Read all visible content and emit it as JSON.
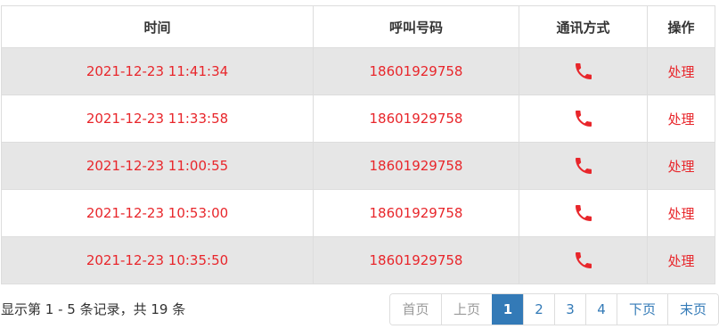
{
  "table": {
    "headers": [
      "时间",
      "呼叫号码",
      "通讯方式",
      "操作"
    ],
    "rows": [
      {
        "time": "2021-12-23 11:41:34",
        "number": "18601929758",
        "icon": "phone-icon",
        "action": "处理"
      },
      {
        "time": "2021-12-23 11:33:58",
        "number": "18601929758",
        "icon": "phone-icon",
        "action": "处理"
      },
      {
        "time": "2021-12-23 11:00:55",
        "number": "18601929758",
        "icon": "phone-icon",
        "action": "处理"
      },
      {
        "time": "2021-12-23 10:53:00",
        "number": "18601929758",
        "icon": "phone-icon",
        "action": "处理"
      },
      {
        "time": "2021-12-23 10:35:50",
        "number": "18601929758",
        "icon": "phone-icon",
        "action": "处理"
      }
    ]
  },
  "summary": "显示第 1 - 5 条记录，共 19 条",
  "pagination": {
    "first": "首页",
    "prev": "上页",
    "pages": [
      "1",
      "2",
      "3",
      "4"
    ],
    "current_page": "1",
    "next": "下页",
    "last": "末页"
  },
  "colors": {
    "accent": "#e8262b",
    "active_page": "#337ab7",
    "stripe": "#e6e6e6"
  }
}
